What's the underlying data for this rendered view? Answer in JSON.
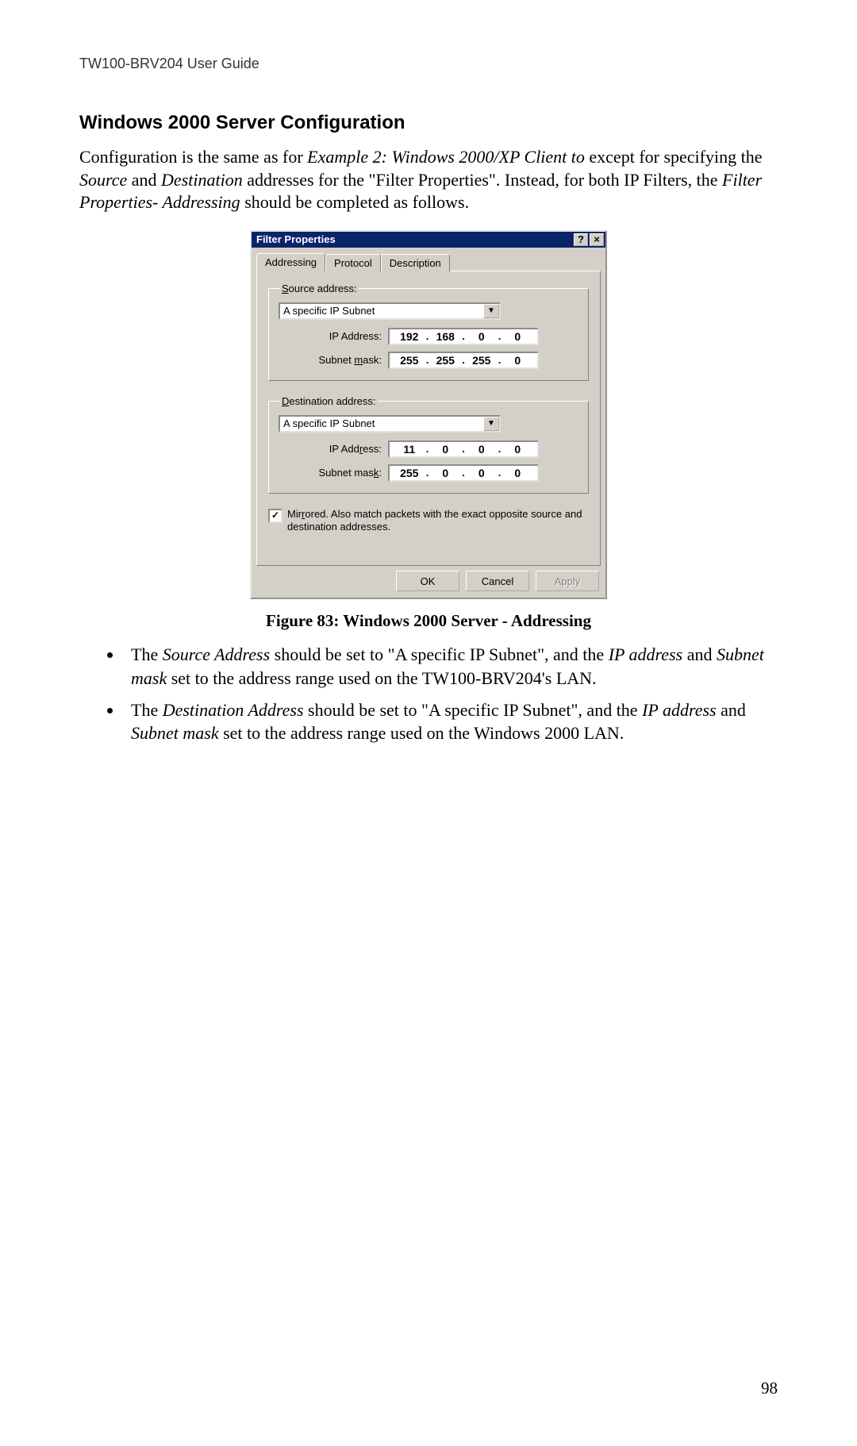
{
  "header": {
    "guide": "TW100-BRV204 User Guide"
  },
  "section": {
    "title": "Windows 2000 Server Configuration"
  },
  "intro": {
    "t1": "Configuration is the same as for ",
    "i1": "Example 2: Windows 2000/XP Client to",
    "t2": "  except for specifying the ",
    "i2": "Source",
    "t3": " and ",
    "i3": "Destination",
    "t4": " addresses for the \"Filter Properties\". Instead, for both IP Filters, the ",
    "i4": "Filter Properties- Addressing",
    "t5": " should be completed as follows."
  },
  "dialog": {
    "title": "Filter Properties",
    "help_btn": "?",
    "close_btn": "×",
    "tabs": {
      "addressing": "Addressing",
      "protocol": "Protocol",
      "description": "Description"
    },
    "source": {
      "legend_pre": "S",
      "legend_suffix": "ource address:",
      "dropdown": "A specific IP Subnet",
      "ip_label": "IP Address:",
      "ip": [
        "192",
        "168",
        "0",
        "0"
      ],
      "mask_label_pre": "Subnet ",
      "mask_label_u": "m",
      "mask_label_post": "ask:",
      "mask": [
        "255",
        "255",
        "255",
        "0"
      ]
    },
    "dest": {
      "legend_pre": "D",
      "legend_suffix": "estination address:",
      "dropdown": "A specific IP Subnet",
      "ip_label_pre": "IP Add",
      "ip_label_u": "r",
      "ip_label_post": "ess:",
      "ip": [
        "11",
        "0",
        "0",
        "0"
      ],
      "mask_label_pre": "Subnet mas",
      "mask_label_u": "k",
      "mask_label_post": ":",
      "mask": [
        "255",
        "0",
        "0",
        "0"
      ]
    },
    "mirrored_pre": "Mir",
    "mirrored_u": "r",
    "mirrored_post": "ored. Also match packets with the exact opposite source and destination addresses.",
    "buttons": {
      "ok": "OK",
      "cancel": "Cancel",
      "apply": "Apply"
    }
  },
  "figure": {
    "caption": "Figure 83: Windows 2000 Server - Addressing"
  },
  "bullets": {
    "b1": {
      "t1": "The ",
      "i1": "Source Address",
      "t2": " should be set to \"A specific IP Subnet\", and the ",
      "i2": "IP address",
      "t3": " and ",
      "i3": "Subnet mask",
      "t4": " set to the address range used on the TW100-BRV204's LAN."
    },
    "b2": {
      "t1": "The ",
      "i1": "Destination Address",
      "t2": " should be set to \"A specific IP Subnet\", and the ",
      "i2": "IP address",
      "t3": " and ",
      "i3": "Subnet mask",
      "t4": " set to the address range used on the Windows 2000 LAN."
    }
  },
  "page_number": "98"
}
